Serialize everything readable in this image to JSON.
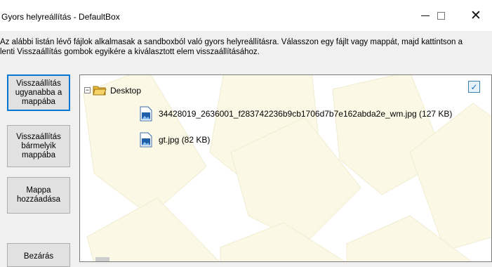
{
  "window": {
    "title": "Gyors helyreállítás - DefaultBox",
    "minimize_glyph": "—",
    "close_glyph": "✕"
  },
  "description": "Az alábbi listán lévő fájlok alkalmasak a sandboxból való gyors helyreállításra.  Válasszon egy fájlt vagy mappát, majd kattintson a\nlenti Visszaállítás gombok egyikére a kiválasztott elem visszaállításához.",
  "buttons": {
    "restore_same": "Visszaállítás\nugyanabba a\nmappába",
    "restore_any": "Visszaállítás\nbármelyik\nmappába",
    "add_folder": "Mappa\nhozzáadása",
    "close": "Bezárás"
  },
  "tree": {
    "root": {
      "label": "Desktop",
      "expander": "⊟",
      "icon": "folder-icon"
    },
    "files": [
      {
        "label": "34428019_2636001_f283742236b9cb1706d7b7e162abda2e_wm.jpg  (127 KB)",
        "icon": "image-file-icon"
      },
      {
        "label": "gt.jpg  (82 KB)",
        "icon": "image-file-icon"
      }
    ],
    "checkbox_mark": "✓"
  },
  "colors": {
    "accent": "#0078d7",
    "background_tile": "#fbf9e6",
    "folder": "#f6c945"
  }
}
